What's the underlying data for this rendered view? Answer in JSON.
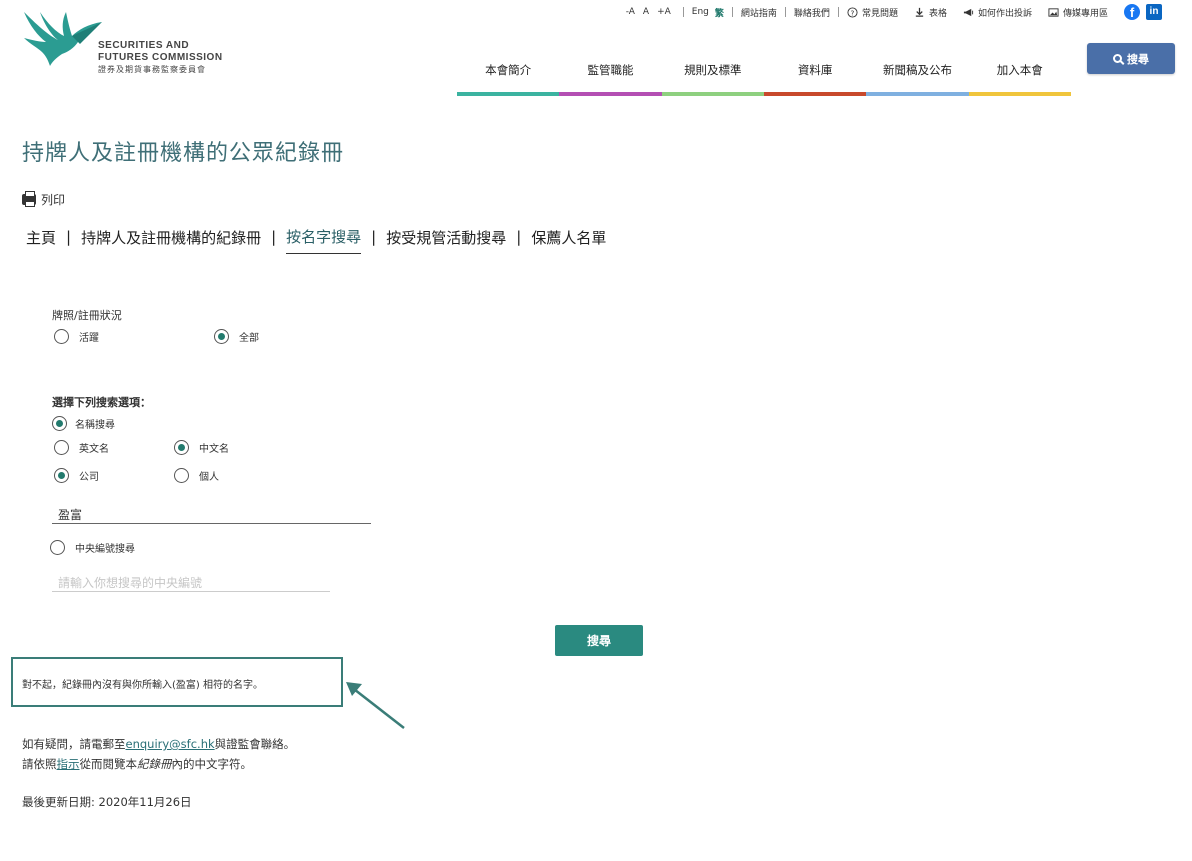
{
  "logo": {
    "line1": "SECURITIES AND",
    "line2": "FUTURES COMMISSION",
    "line3": "證券及期貨事務監察委員會"
  },
  "utility": {
    "font_small": "-A",
    "font_normal": "A",
    "font_large": "+A",
    "lang_en": "Eng",
    "lang_tc": "繁",
    "sitemap": "網站指南",
    "contact": "聯絡我們",
    "faq": "常見問題",
    "forms": "表格",
    "complaint": "如何作出投訴",
    "media": "傳媒專用區"
  },
  "nav": {
    "items": [
      {
        "label": "本會簡介",
        "color": "#3bb3a0"
      },
      {
        "label": "監管職能",
        "color": "#b44fb3"
      },
      {
        "label": "規則及標準",
        "color": "#8ed07f"
      },
      {
        "label": "資料庫",
        "color": "#c8492c"
      },
      {
        "label": "新聞稿及公布",
        "color": "#7fb0e0"
      },
      {
        "label": "加入本會",
        "color": "#f0c53c"
      }
    ],
    "search_label": "搜尋"
  },
  "page": {
    "title": "持牌人及註冊機構的公眾紀錄冊",
    "print_label": "列印"
  },
  "subnav": {
    "home": "主頁",
    "register": "持牌人及註冊機構的紀錄冊",
    "by_name": "按名字搜尋",
    "by_activity": "按受規管活動搜尋",
    "sponsors": "保薦人名單"
  },
  "form": {
    "status_label": "牌照/註冊狀況",
    "status_active": "活躍",
    "status_all": "全部",
    "options_label": "選擇下列搜索選項：",
    "name_search": "名稱搜尋",
    "english_name": "英文名",
    "chinese_name": "中文名",
    "company": "公司",
    "individual": "個人",
    "name_value": "盈富",
    "central_search": "中央編號搜尋",
    "central_placeholder": "請輸入你想搜尋的中央編號",
    "submit_label": "搜尋"
  },
  "result": {
    "message": "對不起，紀錄冊內沒有與你所輸入(盈富) 相符的名字。"
  },
  "footer": {
    "enquiry_prefix": "如有疑問，請電郵至",
    "enquiry_email": "enquiry@sfc.hk",
    "enquiry_suffix": "與證監會聯絡。",
    "guide_prefix": "請依照",
    "guide_link": "指示",
    "guide_middle": "從而閱覽本",
    "guide_em": "紀錄冊",
    "guide_suffix": "內的中文字符。",
    "last_updated": "最後更新日期: 2020年11月26日"
  },
  "colors": {
    "accent": "#227a6d",
    "title": "#3f6f77",
    "search_button": "#4a6fa8",
    "submit_button": "#2a8a80"
  }
}
